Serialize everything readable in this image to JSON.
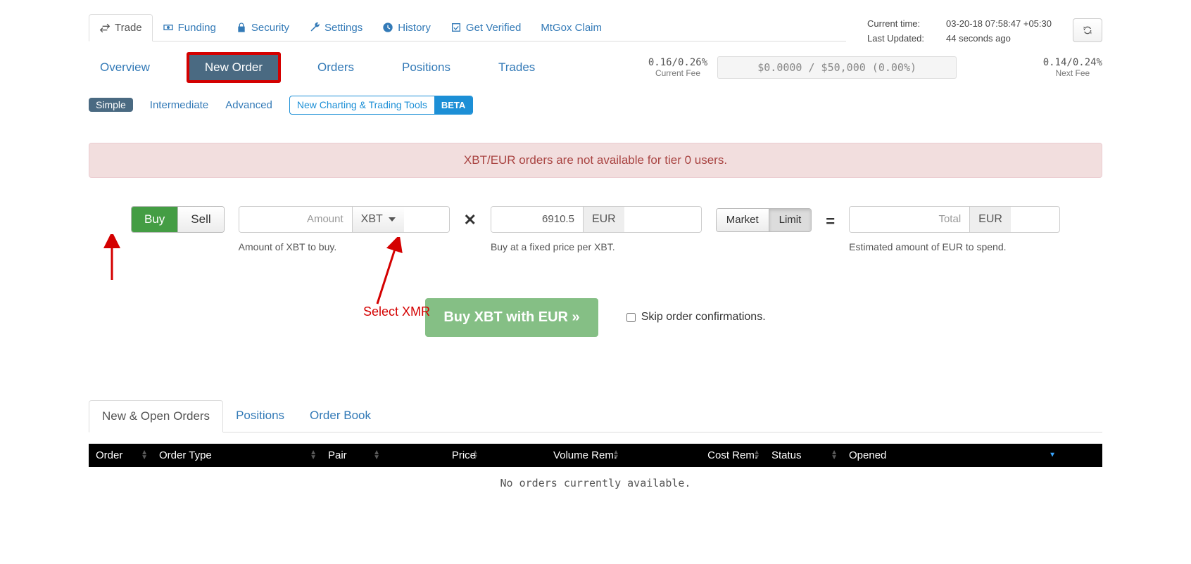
{
  "header": {
    "current_time_label": "Current time:",
    "current_time_value": "03-20-18 07:58:47 +05:30",
    "last_updated_label": "Last Updated:",
    "last_updated_value": "44 seconds ago"
  },
  "main_tabs": {
    "trade": "Trade",
    "funding": "Funding",
    "security": "Security",
    "settings": "Settings",
    "history": "History",
    "get_verified": "Get Verified",
    "mtgox": "MtGox Claim"
  },
  "sub_tabs": {
    "overview": "Overview",
    "new_order": "New Order",
    "orders": "Orders",
    "positions": "Positions",
    "trades": "Trades"
  },
  "fees": {
    "current_value": "0.16/0.26%",
    "current_label": "Current Fee",
    "volume_display": "$0.0000 / $50,000 (0.00%)",
    "next_value": "0.14/0.24%",
    "next_label": "Next Fee"
  },
  "modes": {
    "simple": "Simple",
    "intermediate": "Intermediate",
    "advanced": "Advanced",
    "beta_text": "New Charting & Trading Tools",
    "beta_tag": "BETA"
  },
  "alert": "XBT/EUR orders are not available for tier 0 users.",
  "form": {
    "buy": "Buy",
    "sell": "Sell",
    "amount_placeholder": "Amount",
    "amount_unit": "XBT",
    "amount_help": "Amount of XBT to buy.",
    "price_value": "6910.5",
    "price_unit": "EUR",
    "price_help": "Buy at a fixed price per XBT.",
    "market": "Market",
    "limit": "Limit",
    "total_placeholder": "Total",
    "total_unit": "EUR",
    "total_help": "Estimated amount of EUR to spend.",
    "submit": "Buy XBT with EUR »",
    "skip_label": "Skip order confirmations."
  },
  "bottom": {
    "tabs": {
      "new_open": "New & Open Orders",
      "positions": "Positions",
      "order_book": "Order Book"
    },
    "columns": {
      "order": "Order",
      "order_type": "Order Type",
      "pair": "Pair",
      "price": "Price",
      "vol_rem": "Volume Rem.",
      "cost_rem": "Cost Rem.",
      "status": "Status",
      "opened": "Opened"
    },
    "empty": "No orders currently available."
  },
  "annotations": {
    "select_xmr": "Select XMR"
  }
}
